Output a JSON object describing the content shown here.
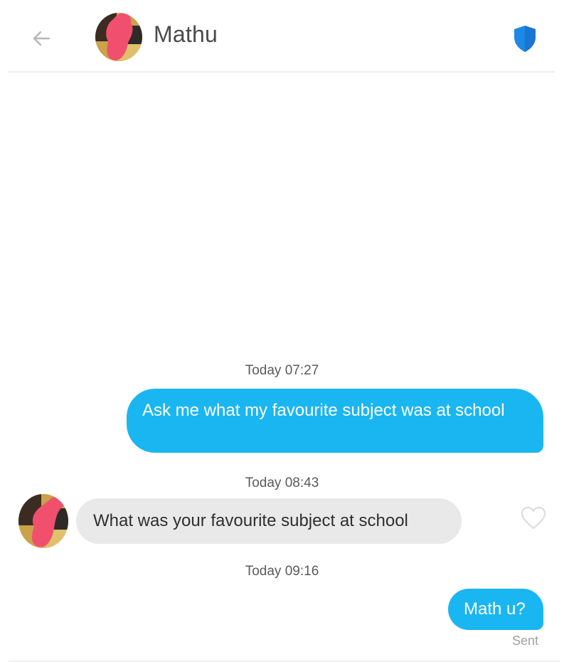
{
  "header": {
    "contact_name": "Mathu",
    "back_icon": "arrow-left-icon",
    "shield_icon": "shield-icon",
    "shield_color": "#1e88e5"
  },
  "conversation": [
    {
      "timestamp": "Today 07:27",
      "direction": "outgoing",
      "text": "Ask me what my favourite subject was at school"
    },
    {
      "timestamp": "Today 08:43",
      "direction": "incoming",
      "text": "What was your favourite subject at school",
      "like_icon": "heart-outline-icon"
    },
    {
      "timestamp": "Today 09:16",
      "direction": "outgoing",
      "text": "Math u?",
      "status": "Sent"
    }
  ],
  "colors": {
    "outgoing_bubble": "#1ab6f1",
    "incoming_bubble": "#e9e9ea",
    "avatar_redaction": "#f0506e"
  }
}
